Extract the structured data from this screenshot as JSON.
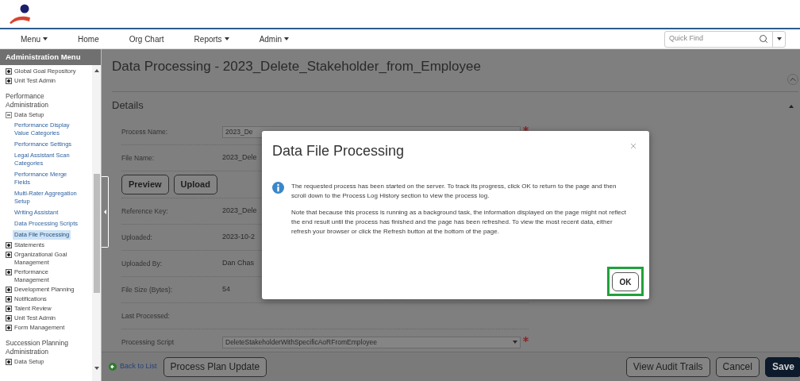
{
  "nav": {
    "items": [
      {
        "label": "Menu",
        "dropdown": true
      },
      {
        "label": "Home",
        "dropdown": false
      },
      {
        "label": "Org Chart",
        "dropdown": false
      },
      {
        "label": "Reports",
        "dropdown": true
      },
      {
        "label": "Admin",
        "dropdown": true
      }
    ],
    "search": {
      "placeholder": "Quick Find"
    }
  },
  "sidebar": {
    "title": "Administration Menu",
    "sections": [
      {
        "items": [
          {
            "kind": "node",
            "label": "Global Goal Repository",
            "expanded": false
          },
          {
            "kind": "node",
            "label": "Unit Test Admin",
            "expanded": false
          }
        ]
      },
      {
        "title": "Performance Administration",
        "items": [
          {
            "kind": "node",
            "label": "Data Setup",
            "expanded": true,
            "children": [
              {
                "kind": "link",
                "label": "Performance Display Value Categories",
                "selected": false
              },
              {
                "kind": "link",
                "label": "Performance Settings",
                "selected": false
              },
              {
                "kind": "link",
                "label": "Legal Assistant Scan Categories",
                "selected": false
              },
              {
                "kind": "link",
                "label": "Performance Merge Fields",
                "selected": false
              },
              {
                "kind": "link",
                "label": "Multi-Rater Aggregation Setup",
                "selected": false
              },
              {
                "kind": "link",
                "label": "Writing Assistant",
                "selected": false
              },
              {
                "kind": "link",
                "label": "Data Processing Scripts",
                "selected": false
              },
              {
                "kind": "link",
                "label": "Data File Processing",
                "selected": true
              }
            ]
          },
          {
            "kind": "node",
            "label": "Statements",
            "expanded": false
          },
          {
            "kind": "node",
            "label": "Organizational Goal Management",
            "expanded": false
          },
          {
            "kind": "node",
            "label": "Performance Management",
            "expanded": false
          },
          {
            "kind": "node",
            "label": "Development Planning",
            "expanded": false
          },
          {
            "kind": "node",
            "label": "Notifications",
            "expanded": false
          },
          {
            "kind": "node",
            "label": "Talent Review",
            "expanded": false
          },
          {
            "kind": "node",
            "label": "Unit Test Admin",
            "expanded": false
          },
          {
            "kind": "node",
            "label": "Form Management",
            "expanded": false
          }
        ]
      },
      {
        "title": "Succession Planning Administration",
        "items": [
          {
            "kind": "node",
            "label": "Data Setup",
            "expanded": false
          }
        ]
      }
    ]
  },
  "page": {
    "title": "Data Processing - 2023_Delete_Stakeholder_from_Employee",
    "section_title": "Details",
    "fields": [
      {
        "kind": "input",
        "label": "Process Name:",
        "value": "2023_De",
        "required": true
      },
      {
        "kind": "text",
        "label": "File Name:",
        "value": "2023_Dele"
      },
      {
        "kind": "buttons",
        "buttons": [
          "Preview",
          "Upload"
        ]
      },
      {
        "kind": "text",
        "label": "Reference Key:",
        "value": "2023_Dele"
      },
      {
        "kind": "text",
        "label": "Uploaded:",
        "value": "2023-10-2"
      },
      {
        "kind": "text",
        "label": "Uploaded By:",
        "value": "Dan Chas"
      },
      {
        "kind": "text",
        "label": "File Size (Bytes):",
        "value": "54"
      },
      {
        "kind": "text",
        "label": "Last Processed:"
      },
      {
        "kind": "select",
        "label": "Processing Script",
        "value": "DeleteStakeholderWithSpecificAoRFromEmployee",
        "required": true
      }
    ]
  },
  "footer": {
    "back_link": "Back to List",
    "left_buttons": [
      "Process Plan Update"
    ],
    "right_buttons": [
      {
        "label": "View Audit Trails",
        "kind": "outline"
      },
      {
        "label": "Cancel",
        "kind": "outline"
      },
      {
        "label": "Save",
        "kind": "primary"
      }
    ]
  },
  "dialog": {
    "title": "Data File Processing",
    "paragraphs": [
      "The requested process has been started on the server. To track its progress, click OK to return to the page and then scroll down to the Process Log History section to view the process log.",
      "Note that because this process is running as a background task, the information displayed on the page might not reflect the end result until the process has finished and the page has been refreshed. To view the most recent data, either refresh your browser or click the Refresh button at the bottom of the page."
    ],
    "ok": {
      "label": "OK",
      "highlighted": true
    }
  }
}
